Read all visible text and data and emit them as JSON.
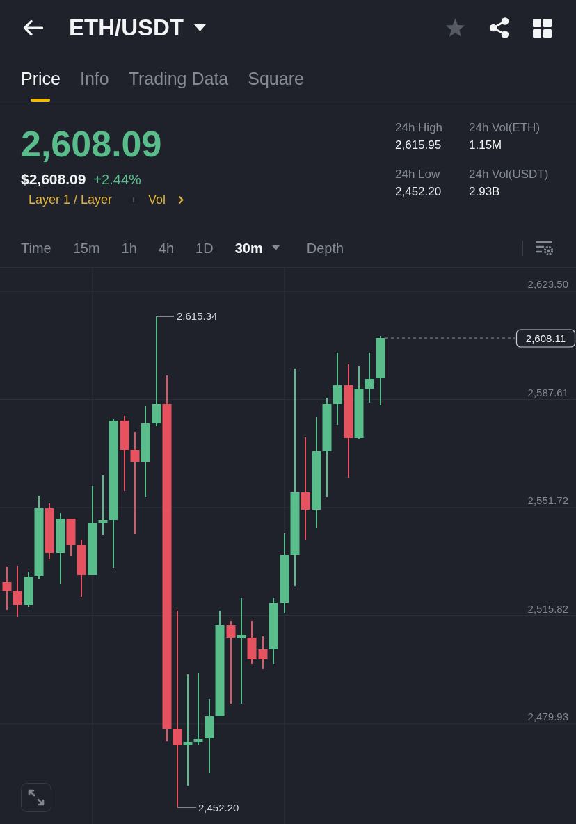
{
  "header": {
    "title": "ETH/USDT",
    "favorite": false
  },
  "tabs": [
    {
      "label": "Price",
      "selected": true
    },
    {
      "label": "Info",
      "selected": false
    },
    {
      "label": "Trading Data",
      "selected": false
    },
    {
      "label": "Square",
      "selected": false
    }
  ],
  "ticker": {
    "last_price": "2,608.09",
    "rising": true,
    "price_usd": "$2,608.09",
    "change": "+2.44%",
    "tags": [
      "Layer 1 / Layer",
      "Vol"
    ]
  },
  "stats": [
    {
      "label": "24h High",
      "value": "2,615.95"
    },
    {
      "label": "24h Vol(ETH)",
      "value": "1.15M"
    },
    {
      "label": "24h Low",
      "value": "2,452.20"
    },
    {
      "label": "24h Vol(USDT)",
      "value": "2.93B"
    }
  ],
  "chart_options": [
    {
      "label": "Time",
      "selected": false,
      "dropdown": false
    },
    {
      "label": "15m",
      "selected": false,
      "dropdown": false
    },
    {
      "label": "1h",
      "selected": false,
      "dropdown": false
    },
    {
      "label": "4h",
      "selected": false,
      "dropdown": false
    },
    {
      "label": "1D",
      "selected": false,
      "dropdown": false
    },
    {
      "label": "30m",
      "selected": true,
      "dropdown": true
    },
    {
      "label": "Depth",
      "selected": false,
      "dropdown": false
    }
  ],
  "chart": {
    "price_axis": [
      "2,623.50",
      "2,587.61",
      "2,551.72",
      "2,515.82",
      "2,479.93"
    ],
    "high_label": "2,615.34",
    "low_label": "2,452.20",
    "last_price_tag": "2,608.11"
  }
}
